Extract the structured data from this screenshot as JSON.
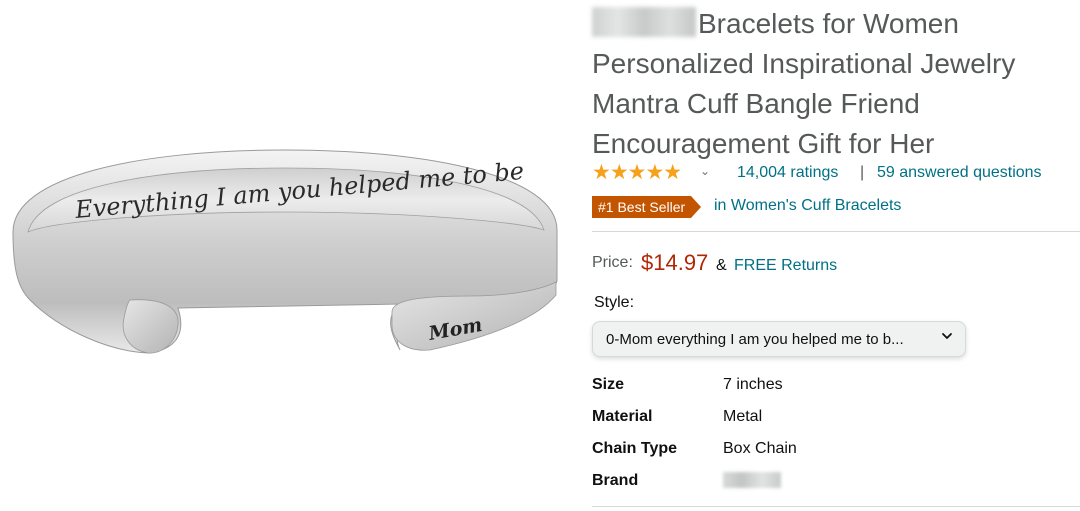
{
  "product": {
    "title_visible": "Bracelets for Women Personalized Inspirational Jewelry Mantra Cuff Bangle Friend Encouragement Gift for Her",
    "title_prefix_fragment": "ff",
    "engraving_inside": "Everything I am you helped me to be",
    "engraving_outside": "Mom"
  },
  "rating": {
    "stars_display": "★★★★★",
    "stars_value": 4.8,
    "ratings_count": "14,004 ratings",
    "separator": "|",
    "answered_questions": "59 answered questions"
  },
  "best_seller": {
    "badge": "#1 Best Seller",
    "category": "in Women's Cuff Bracelets"
  },
  "price": {
    "label": "Price:",
    "value": "$14.97",
    "amp": "&",
    "free_returns": "FREE Returns"
  },
  "style": {
    "label": "Style:",
    "selected": "0-Mom everything I am you helped me to b..."
  },
  "specs": [
    {
      "key": "Size",
      "value": "7 inches"
    },
    {
      "key": "Material",
      "value": "Metal"
    },
    {
      "key": "Chain Type",
      "value": "Box Chain"
    },
    {
      "key": "Brand",
      "value": "ff"
    }
  ],
  "colors": {
    "link": "#007185",
    "price": "#b12704",
    "star": "#f6a11b",
    "badge": "#c45500"
  },
  "icons": [
    "chevron-down-icon",
    "star-icon"
  ]
}
